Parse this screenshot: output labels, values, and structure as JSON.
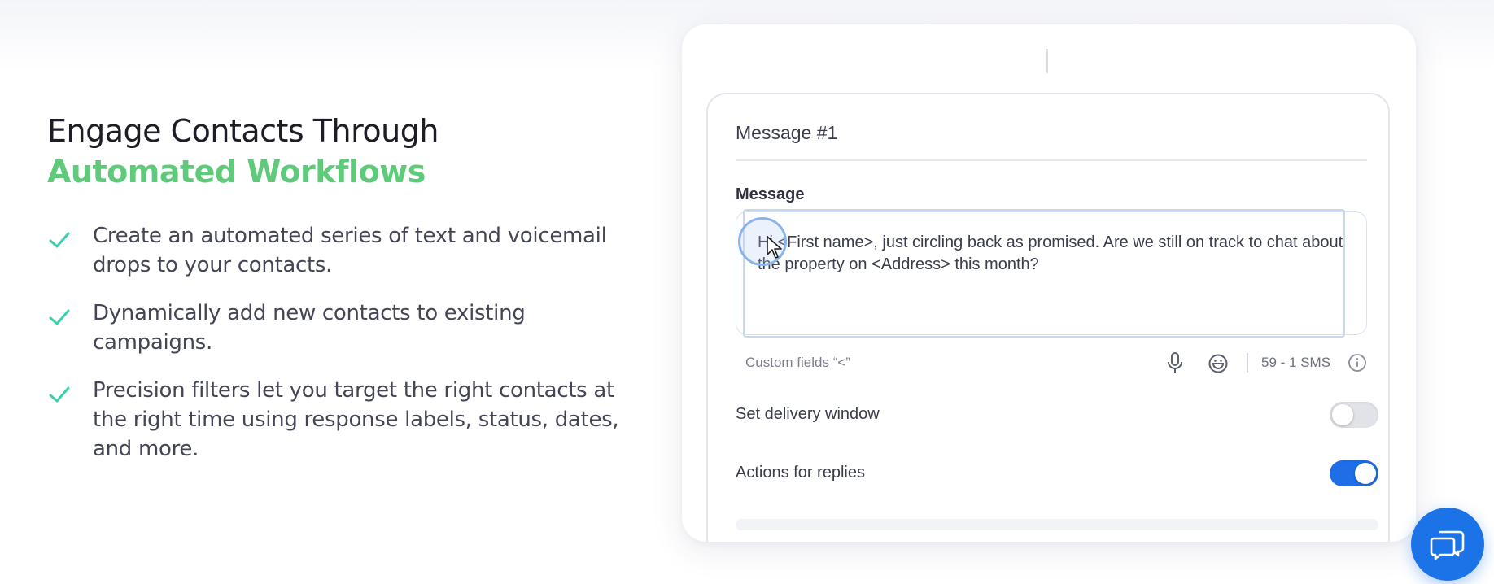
{
  "hero": {
    "headline_line1": "Engage Contacts Through",
    "headline_line2": "Automated Workflows",
    "features": [
      "Create an automated series of text and voicemail drops to your contacts.",
      "Dynamically add new contacts to existing campaigns.",
      "Precision filters let you target the right contacts at the right time using response labels, status, dates, and more."
    ]
  },
  "card": {
    "title": "Message #1",
    "message_label": "Message",
    "message_text": "Hi <First name>, just circling back as promised. Are we still on track to chat about the property on <Address> this month?",
    "custom_fields_hint": "Custom fields “<”",
    "sms_count": "59 - 1 SMS",
    "settings": [
      {
        "label": "Set delivery window",
        "enabled": false
      },
      {
        "label": "Actions for replies",
        "enabled": true
      }
    ]
  },
  "icons": {
    "check": "check-icon",
    "mic": "microphone-icon",
    "emoji": "emoji-icon",
    "info": "info-icon",
    "chat": "chat-bubbles-icon"
  },
  "colors": {
    "accent_green": "#5fca7a",
    "check_teal": "#3ccfae",
    "toggle_on": "#1e6ee8",
    "chat_button": "#1c73e8"
  }
}
